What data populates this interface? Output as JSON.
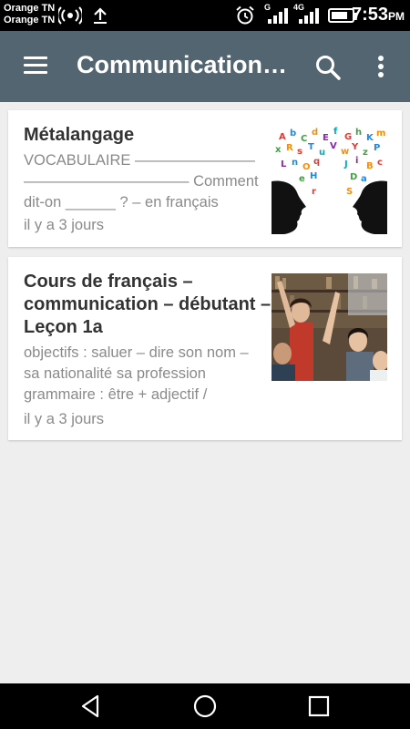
{
  "status_bar": {
    "carrier_1": "Orange TN",
    "carrier_2": "Orange TN",
    "network_label_1": "G",
    "network_label_2": "4G",
    "time": "7:53",
    "ampm": "PM"
  },
  "app_bar": {
    "title": "Communication…",
    "color": "#526570"
  },
  "articles": [
    {
      "title": "Métalangage",
      "excerpt": "VOCABULAIRE ———————— ——————————— Comment dit-on ______ ?  – en français",
      "time": "il y a 3 jours",
      "image": "speech-bubbles-letters-image"
    },
    {
      "title": "Cours de français – communication – débutant – Leçon 1a",
      "excerpt": "objectifs : saluer – dire son nom – sa nationalité sa profession grammaire : être + adjectif /",
      "time": "il y a 3 jours",
      "image": "students-classroom-photo"
    }
  ]
}
